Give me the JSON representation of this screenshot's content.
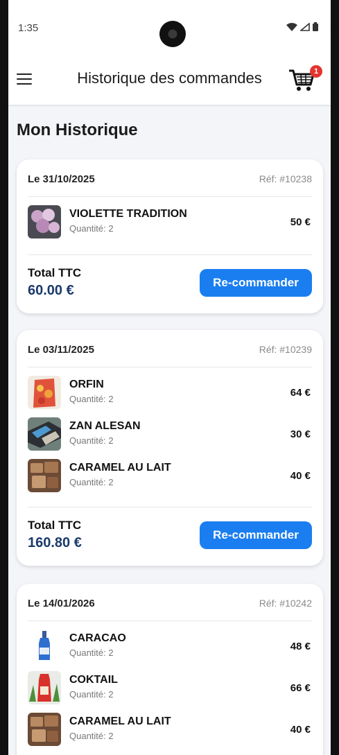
{
  "status_bar": {
    "time": "1:35"
  },
  "app_bar": {
    "title": "Historique des commandes",
    "cart_badge": "1"
  },
  "page_heading": "Mon Historique",
  "orders": [
    {
      "date": "Le 31/10/2025",
      "ref": "Réf: #10238",
      "items": [
        {
          "name": "VIOLETTE TRADITION",
          "qty": "Quantité: 2",
          "price": "50 €"
        }
      ],
      "total_label": "Total TTC",
      "total_value": "60.00 €",
      "reorder_label": "Re-commander"
    },
    {
      "date": "Le 03/11/2025",
      "ref": "Réf: #10239",
      "items": [
        {
          "name": "ORFIN",
          "qty": "Quantité: 2",
          "price": "64 €"
        },
        {
          "name": "ZAN ALESAN",
          "qty": "Quantité: 2",
          "price": "30 €"
        },
        {
          "name": "CARAMEL AU LAIT",
          "qty": "Quantité: 2",
          "price": "40 €"
        }
      ],
      "total_label": "Total TTC",
      "total_value": "160.80 €",
      "reorder_label": "Re-commander"
    },
    {
      "date": "Le 14/01/2026",
      "ref": "Réf: #10242",
      "items": [
        {
          "name": "CARACAO",
          "qty": "Quantité: 2",
          "price": "48 €"
        },
        {
          "name": "COKTAIL",
          "qty": "Quantité: 2",
          "price": "66 €"
        },
        {
          "name": "CARAMEL AU LAIT",
          "qty": "Quantité: 2",
          "price": "40 €"
        }
      ]
    }
  ],
  "colors": {
    "accent": "#1a7ef0",
    "total_text": "#1b3a6b",
    "badge": "#e3342f"
  }
}
